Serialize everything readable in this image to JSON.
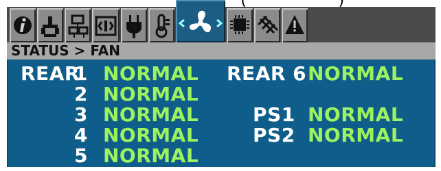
{
  "tabs": [
    {
      "id": "info",
      "icon": "info-icon"
    },
    {
      "id": "network",
      "icon": "network-icon"
    },
    {
      "id": "servers",
      "icon": "servers-icon"
    },
    {
      "id": "io",
      "icon": "io-icon"
    },
    {
      "id": "power",
      "icon": "power-plug-icon"
    },
    {
      "id": "temperature",
      "icon": "thermometer-icon"
    },
    {
      "id": "fan",
      "icon": "fan-icon",
      "active": true
    },
    {
      "id": "cpu",
      "icon": "chip-icon"
    },
    {
      "id": "modules",
      "icon": "grid-icon"
    },
    {
      "id": "warning",
      "icon": "warning-icon"
    }
  ],
  "breadcrumb": "STATUS > FAN",
  "fans": {
    "rear_group_label": "REAR",
    "rows": [
      {
        "num": "1",
        "status": "NORMAL"
      },
      {
        "num": "2",
        "status": "NORMAL"
      },
      {
        "num": "3",
        "status": "NORMAL"
      },
      {
        "num": "4",
        "status": "NORMAL"
      },
      {
        "num": "5",
        "status": "NORMAL"
      }
    ],
    "rear6": {
      "label": "REAR 6",
      "status": "NORMAL"
    },
    "ps1": {
      "label": "PS1",
      "status": "NORMAL"
    },
    "ps2": {
      "label": "PS2",
      "status": "NORMAL"
    }
  },
  "colors": {
    "content_bg": "#0f5d8a",
    "status_normal": "#9df25f",
    "label": "#ffffff"
  }
}
